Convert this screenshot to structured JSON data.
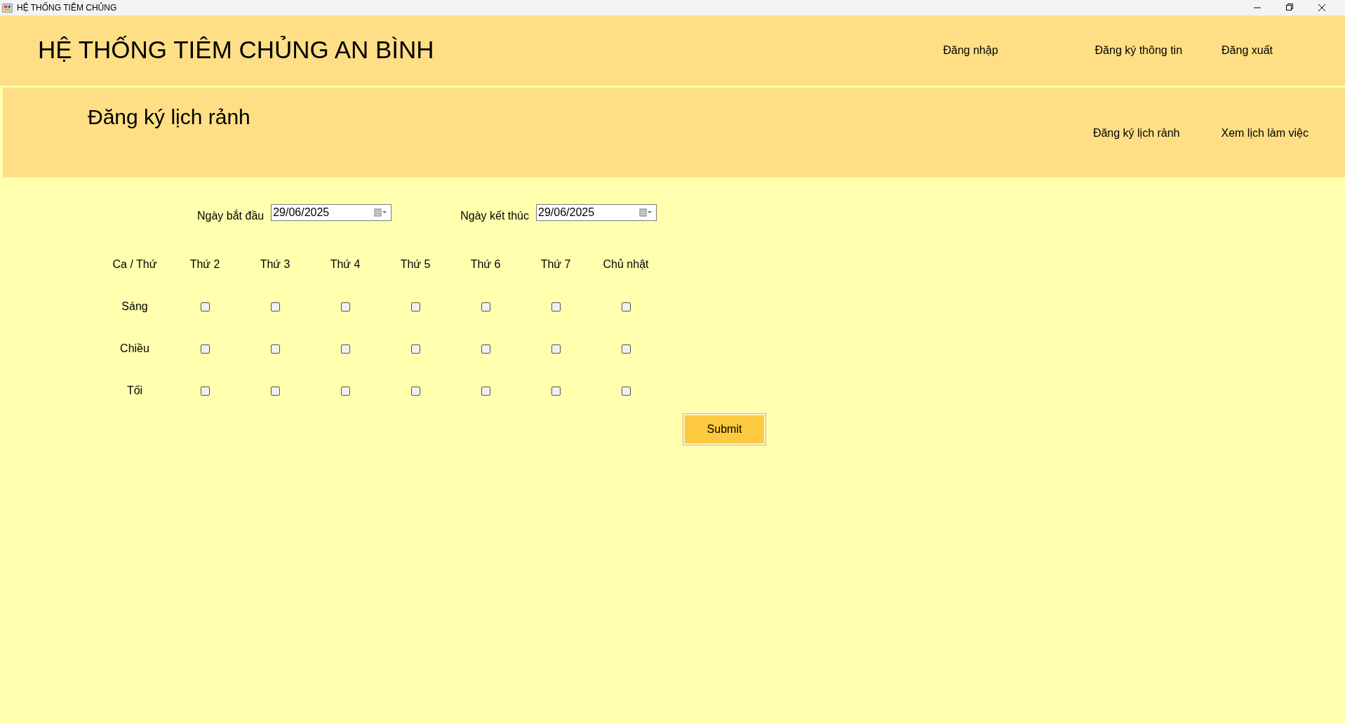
{
  "window": {
    "title": "HỆ THỐNG TIÊM CHỦNG"
  },
  "header": {
    "title": "HỆ THỐNG TIÊM CHỦNG AN BÌNH",
    "nav": [
      "Đăng nhập",
      "Đăng ký thông tin",
      "Đăng xuất"
    ]
  },
  "subheader": {
    "title": "Đăng ký lịch rảnh",
    "nav": [
      "Đăng ký lịch rảnh",
      "Xem lịch làm việc"
    ]
  },
  "start_date": {
    "label": "Ngày bắt đầu",
    "value": "29/06/2025"
  },
  "end_date": {
    "label": "Ngày kết thúc",
    "value": "29/06/2025"
  },
  "schedule": {
    "corner": "Ca / Thứ",
    "columns": [
      "Thứ 2",
      "Thứ 3",
      "Thứ 4",
      "Thứ 5",
      "Thứ 6",
      "Thứ 7",
      "Chủ nhật"
    ],
    "rows": [
      {
        "label": "Sáng",
        "cells": [
          {
            "checked": false
          },
          {
            "checked": false
          },
          {
            "checked": false
          },
          {
            "checked": false
          },
          {
            "checked": false
          },
          {
            "checked": false
          },
          {
            "checked": false
          }
        ]
      },
      {
        "label": "Chiều",
        "cells": [
          {
            "checked": false
          },
          {
            "checked": false
          },
          {
            "checked": false
          },
          {
            "checked": false
          },
          {
            "checked": false
          },
          {
            "checked": false
          },
          {
            "checked": false
          }
        ]
      },
      {
        "label": "Tối",
        "cells": [
          {
            "checked": false
          },
          {
            "checked": false
          },
          {
            "checked": false
          },
          {
            "checked": false
          },
          {
            "checked": false
          },
          {
            "checked": false
          },
          {
            "checked": false
          }
        ]
      }
    ]
  },
  "submit_button": "Submit"
}
